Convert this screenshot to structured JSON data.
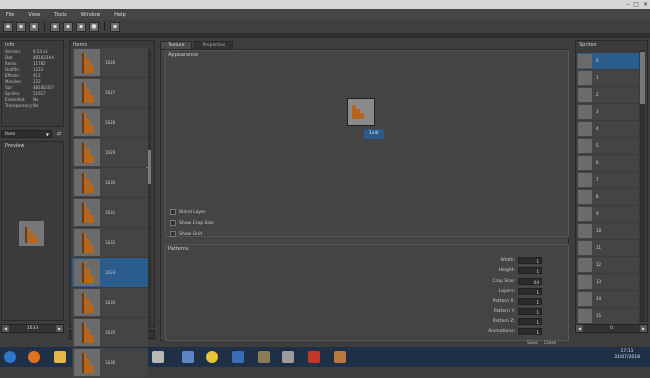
{
  "window": {
    "controls": [
      "–",
      "□",
      "✕"
    ]
  },
  "menu": [
    "File",
    "View",
    "Tools",
    "Window",
    "Help"
  ],
  "toolbar": [
    "new-icon",
    "open-icon",
    "save-icon",
    "compile-icon",
    "find-icon",
    "library-icon",
    "settings-icon",
    "module-icon"
  ],
  "info": {
    "title": "Info",
    "rows": [
      {
        "k": "Version:",
        "v": "8.54 x1"
      },
      {
        "k": "Dat:",
        "v": "4B1823AA"
      },
      {
        "k": "Items:",
        "v": "11782"
      },
      {
        "k": "Outfits:",
        "v": "1223"
      },
      {
        "k": "Effects:",
        "v": "412"
      },
      {
        "k": "Missiles:",
        "v": "122"
      },
      {
        "k": "Spr:",
        "v": "4B18D357"
      },
      {
        "k": "Sprites:",
        "v": "51617"
      },
      {
        "k": "Extended:",
        "v": "No"
      },
      {
        "k": "Transparency:",
        "v": "No"
      }
    ]
  },
  "type_select": {
    "value": "Item"
  },
  "preview": {
    "title": "Preview",
    "nav_value": "1633"
  },
  "items": {
    "title": "Items",
    "rows": [
      "1626",
      "1627",
      "1628",
      "1629",
      "1630",
      "1631",
      "1632",
      "1633",
      "1634",
      "1635",
      "1636"
    ],
    "selected": "1633",
    "range": "1600 - 1699"
  },
  "tabs": [
    "Texture",
    "Properties"
  ],
  "appearance": {
    "title": "Appearance",
    "label": "1x4r"
  },
  "options": [
    "Blend Layer",
    "Show Crop Size",
    "Show Grid"
  ],
  "patterns": {
    "title": "Patterns",
    "props": [
      {
        "label": "Width:",
        "value": "1"
      },
      {
        "label": "Height:",
        "value": "1"
      },
      {
        "label": "Crop Size:",
        "value": "64"
      },
      {
        "label": "Layers:",
        "value": "1"
      },
      {
        "label": "Pattern X:",
        "value": "1"
      },
      {
        "label": "Pattern Y:",
        "value": "1"
      },
      {
        "label": "Pattern Z:",
        "value": "1"
      },
      {
        "label": "Animations:",
        "value": "1"
      }
    ]
  },
  "buttons": {
    "save": "Save",
    "close": "Close"
  },
  "sprites": {
    "title": "Sprites",
    "rows": [
      "0",
      "1",
      "2",
      "3",
      "4",
      "5",
      "6",
      "7",
      "8",
      "9",
      "10",
      "11",
      "12",
      "13",
      "14",
      "15"
    ],
    "selected": "0",
    "nav_value": "0"
  },
  "taskbar": {
    "time": "17:11",
    "date": "31/07/2018"
  }
}
